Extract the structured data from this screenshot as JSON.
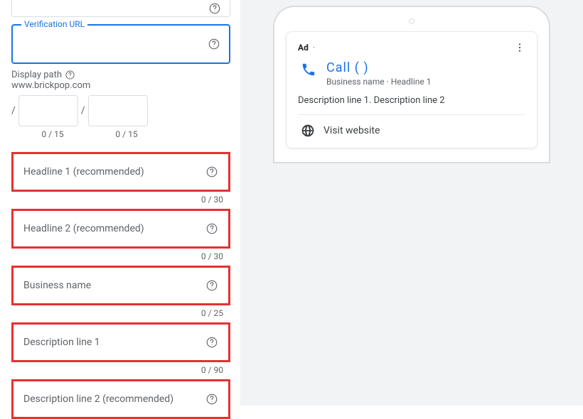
{
  "form": {
    "verification_url": {
      "label": "Verification URL",
      "value": ""
    },
    "display_path": {
      "label": "Display path",
      "domain": "www.brickpop.com",
      "p1": "",
      "p2": "",
      "count1": "0 / 15",
      "count2": "0 / 15"
    },
    "headline1": {
      "placeholder": "Headline 1 (recommended)",
      "counter": "0 / 30"
    },
    "headline2": {
      "placeholder": "Headline 2 (recommended)",
      "counter": "0 / 30"
    },
    "business_name": {
      "placeholder": "Business name",
      "counter": "0 / 25"
    },
    "desc1": {
      "placeholder": "Description line 1",
      "counter": "0 / 90"
    },
    "desc2": {
      "placeholder": "Description line 2 (recommended)"
    }
  },
  "preview": {
    "ad_label": "Ad",
    "ad_dot": "·",
    "call": "Call (       )",
    "biz": "Business name",
    "sep": " · ",
    "hl": "Headline 1",
    "desc": "Description line 1. Description line 2",
    "visit": "Visit website"
  }
}
